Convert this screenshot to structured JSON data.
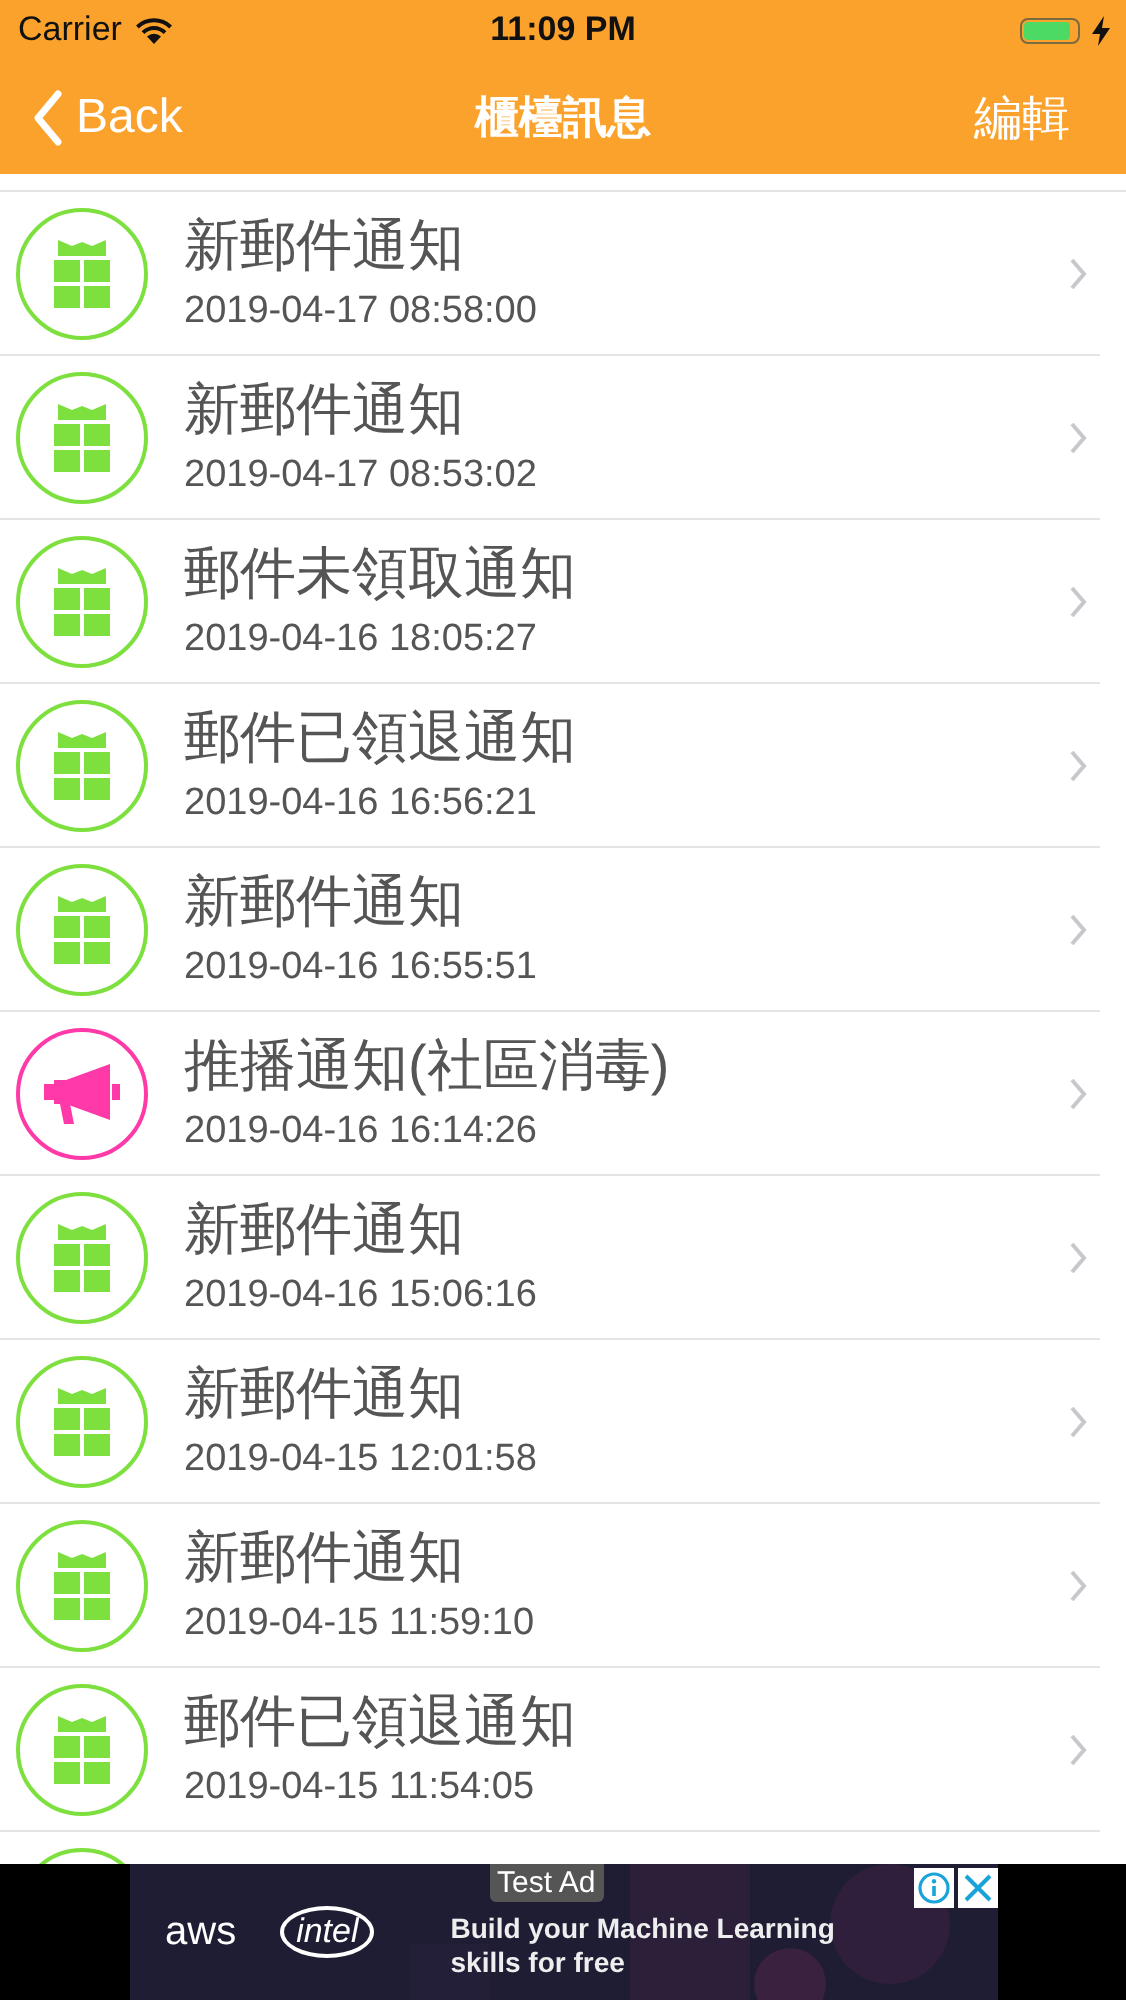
{
  "status_bar": {
    "carrier": "Carrier",
    "time": "11:09 PM",
    "charging": true
  },
  "nav": {
    "back": "Back",
    "title": "櫃檯訊息",
    "action": "編輯"
  },
  "messages": [
    {
      "kind": "parcel",
      "title": "新郵件通知",
      "time": "2019-04-17 08:58:00"
    },
    {
      "kind": "parcel",
      "title": "新郵件通知",
      "time": "2019-04-17 08:53:02"
    },
    {
      "kind": "parcel",
      "title": "郵件未領取通知",
      "time": "2019-04-16 18:05:27"
    },
    {
      "kind": "parcel",
      "title": "郵件已領退通知",
      "time": "2019-04-16 16:56:21"
    },
    {
      "kind": "parcel",
      "title": "新郵件通知",
      "time": "2019-04-16 16:55:51"
    },
    {
      "kind": "broadcast",
      "title": "推播通知(社區消毒)",
      "time": "2019-04-16 16:14:26"
    },
    {
      "kind": "parcel",
      "title": "新郵件通知",
      "time": "2019-04-16 15:06:16"
    },
    {
      "kind": "parcel",
      "title": "新郵件通知",
      "time": "2019-04-15 12:01:58"
    },
    {
      "kind": "parcel",
      "title": "新郵件通知",
      "time": "2019-04-15 11:59:10"
    },
    {
      "kind": "parcel",
      "title": "郵件已領退通知",
      "time": "2019-04-15 11:54:05"
    },
    {
      "kind": "parcel"
    }
  ],
  "ad": {
    "label": "Test Ad",
    "logo_1": "aws",
    "logo_2": "intel",
    "headline": "Build your Machine Learning",
    "subline": "skills for free"
  }
}
